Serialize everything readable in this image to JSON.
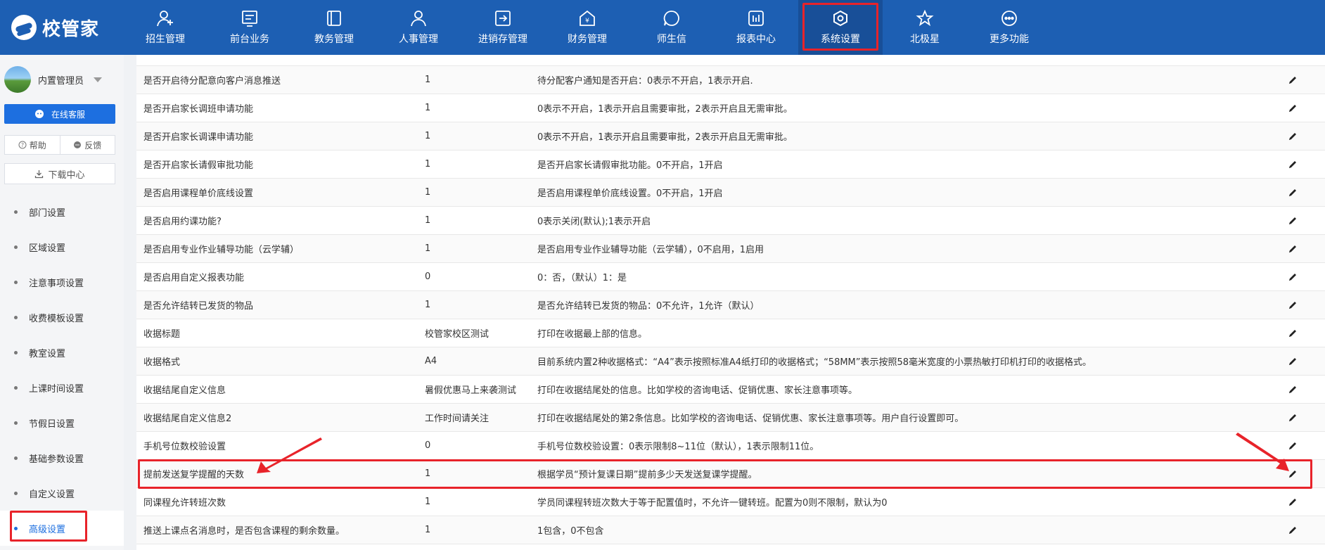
{
  "app": {
    "logo_text": "校管家"
  },
  "nav": [
    {
      "label": "招生管理",
      "icon": "user-add-icon"
    },
    {
      "label": "前台业务",
      "icon": "monitor-icon"
    },
    {
      "label": "教务管理",
      "icon": "book-icon"
    },
    {
      "label": "人事管理",
      "icon": "person-icon"
    },
    {
      "label": "进销存管理",
      "icon": "stock-icon"
    },
    {
      "label": "财务管理",
      "icon": "finance-icon"
    },
    {
      "label": "师生信",
      "icon": "chat-icon"
    },
    {
      "label": "报表中心",
      "icon": "report-icon"
    },
    {
      "label": "系统设置",
      "icon": "settings-icon"
    },
    {
      "label": "北极星",
      "icon": "star-icon"
    },
    {
      "label": "更多功能",
      "icon": "more-icon"
    }
  ],
  "sidebar": {
    "user_name": "内置管理员",
    "service_label": "在线客服",
    "help_label": "帮助",
    "feedback_label": "反馈",
    "download_label": "下载中心",
    "menu": [
      {
        "label": "部门设置"
      },
      {
        "label": "区域设置"
      },
      {
        "label": "注意事项设置"
      },
      {
        "label": "收费模板设置"
      },
      {
        "label": "教室设置"
      },
      {
        "label": "上课时间设置"
      },
      {
        "label": "节假日设置"
      },
      {
        "label": "基础参数设置"
      },
      {
        "label": "自定义设置"
      },
      {
        "label": "高级设置"
      }
    ]
  },
  "rows": [
    {
      "name": "是否开启待分配意向客户消息推送",
      "value": "1",
      "desc": "待分配客户通知是否开启：0表示不开启，1表示开启."
    },
    {
      "name": "是否开启家长调班申请功能",
      "value": "1",
      "desc": "0表示不开启，1表示开启且需要审批，2表示开启且无需审批。"
    },
    {
      "name": "是否开启家长调课申请功能",
      "value": "1",
      "desc": "0表示不开启，1表示开启且需要审批，2表示开启且无需审批。"
    },
    {
      "name": "是否开启家长请假审批功能",
      "value": "1",
      "desc": "是否开启家长请假审批功能。0不开启，1开启"
    },
    {
      "name": "是否启用课程单价底线设置",
      "value": "1",
      "desc": "是否启用课程单价底线设置。0不开启，1开启"
    },
    {
      "name": "是否启用约课功能?",
      "value": "1",
      "desc": "0表示关闭(默认);1表示开启"
    },
    {
      "name": "是否启用专业作业辅导功能（云学辅）",
      "value": "1",
      "desc": "是否启用专业作业辅导功能（云学辅），0不启用，1启用"
    },
    {
      "name": "是否启用自定义报表功能",
      "value": "0",
      "desc": "0：否，（默认）1：是"
    },
    {
      "name": "是否允许结转已发货的物品",
      "value": "1",
      "desc": "是否允许结转已发货的物品：0不允许，1允许（默认）"
    },
    {
      "name": "收据标题",
      "value": "校管家校区测试",
      "desc": "打印在收据最上部的信息。"
    },
    {
      "name": "收据格式",
      "value": "A4",
      "desc": "目前系统内置2种收据格式：“A4”表示按照标准A4纸打印的收据格式；“58MM”表示按照58毫米宽度的小票热敏打印机打印的收据格式。"
    },
    {
      "name": "收据结尾自定义信息",
      "value": "暑假优惠马上来袭测试",
      "desc": "打印在收据结尾处的信息。比如学校的咨询电话、促销优惠、家长注意事项等。"
    },
    {
      "name": "收据结尾自定义信息2",
      "value": "工作时间请关注",
      "desc": "打印在收据结尾处的第2条信息。比如学校的咨询电话、促销优惠、家长注意事项等。用户自行设置即可。"
    },
    {
      "name": "手机号位数校验设置",
      "value": "0",
      "desc": "手机号位数校验设置：0表示限制8~11位（默认），1表示限制11位。"
    },
    {
      "name": "提前发送复学提醒的天数",
      "value": "1",
      "desc": "根据学员“预计复课日期”提前多少天发送复课学提醒。"
    },
    {
      "name": "同课程允许转班次数",
      "value": "1",
      "desc": "学员同课程转班次数大于等于配置值时，不允许一键转班。配置为0则不限制，默认为0"
    },
    {
      "name": "推送上课点名消息时，是否包含课程的剩余数量。",
      "value": "1",
      "desc": "1包含，0不包含"
    }
  ],
  "accent_color": "#1d5fb3",
  "highlight_color": "#e8232a"
}
